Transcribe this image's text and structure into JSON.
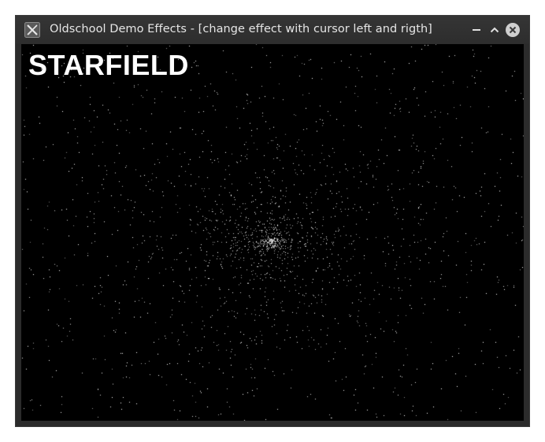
{
  "window": {
    "title": "Oldschool Demo Effects - [change effect with cursor left and rigth]",
    "app_icon": "x-app-icon",
    "buttons": [
      "minimize-icon",
      "maximize-icon",
      "close-icon"
    ]
  },
  "effect": {
    "name": "STARFIELD"
  },
  "colors": {
    "titlebar_bg": "#2e2e2e",
    "title_text": "#e6e6e6",
    "canvas_bg": "#000000",
    "star": "#ffffff"
  }
}
